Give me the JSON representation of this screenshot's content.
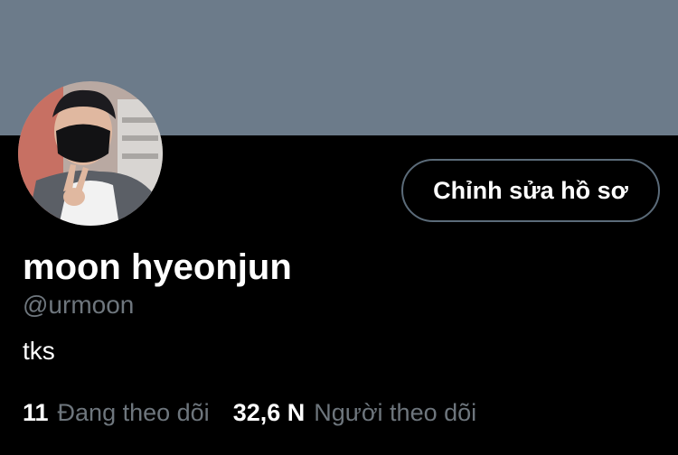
{
  "profile": {
    "display_name": "moon hyeonjun",
    "handle": "@urmoon",
    "bio": "tks",
    "edit_button_label": "Chỉnh sửa hồ sơ"
  },
  "stats": {
    "following_count": "11",
    "following_label": "Đang theo dõi",
    "followers_count": "32,6 N",
    "followers_label": "Người theo dõi"
  },
  "colors": {
    "banner": "#6c7b8a",
    "background": "#000000",
    "secondary_text": "#6e767d",
    "button_border": "#5b6b79"
  }
}
